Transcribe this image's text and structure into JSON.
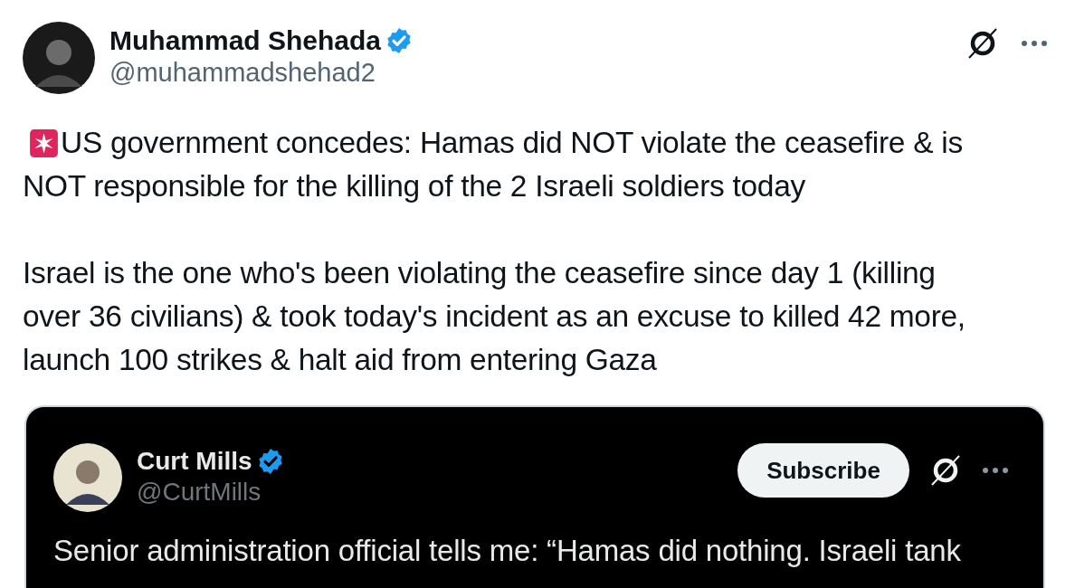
{
  "post": {
    "author": {
      "name": "Muhammad Shehada",
      "handle": "@muhammadshehad2",
      "verified": true
    },
    "paragraphs": [
      {
        "alert": true,
        "lines": [
          "US government concedes: Hamas did NOT violate the ceasefire & is",
          "NOT responsible for the killing of the 2 Israeli soldiers today"
        ]
      },
      {
        "alert": false,
        "lines": [
          "Israel is the one who's been violating the ceasefire since day 1 (killing",
          "over 36 civilians) & took today's incident as an excuse to killed 42 more,",
          "launch 100 strikes & halt aid from entering Gaza"
        ]
      }
    ],
    "quoted": {
      "author": {
        "name": "Curt Mills",
        "handle": "@CurtMills",
        "verified": true
      },
      "button": "Subscribe",
      "lines": [
        "Senior administration official tells me: “Hamas did nothing. Israeli tank"
      ]
    }
  }
}
